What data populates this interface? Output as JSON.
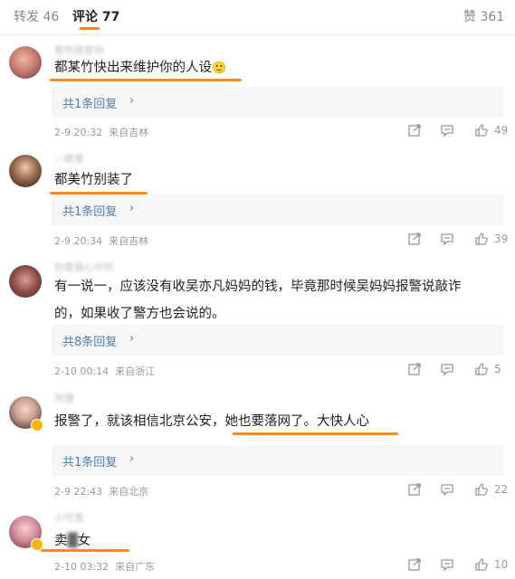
{
  "tabs": {
    "reposts": "转发 46",
    "comments": "评论 77",
    "likes": "赞 361"
  },
  "comments": [
    {
      "username": "爱的就是你",
      "text_line1": "都某竹快出来维护你的人设",
      "text_line2": "",
      "emoji": "🙂",
      "reply": "共1条回复",
      "date": "2-9 20:32",
      "source": "来自吉林",
      "likes": "49"
    },
    {
      "username": "一娘爱",
      "text_line1": "都美竹别装了",
      "text_line2": "",
      "reply": "共1条回复",
      "date": "2-9 20:34",
      "source": "来自吉林",
      "likes": "39"
    },
    {
      "username": "你是我心中的",
      "text_line1": "有一说一，应该没有收吴亦凡妈妈的钱，毕竟那时候吴妈妈报警说敲诈",
      "text_line2": "的，如果收了警方也会说的。",
      "reply": "共8条回复",
      "date": "2-10 00:14",
      "source": "来自浙江",
      "likes": "5"
    },
    {
      "username": "阿狸",
      "text_line1": "报警了，就该相信北京公安，她也要落网了。大快人心",
      "text_line2": "",
      "reply": "共1条回复",
      "date": "2-9 22:43",
      "source": "来自北京",
      "likes": "22"
    },
    {
      "username": "小可爱",
      "text_line1": "卖",
      "text_line2": "女",
      "reply": "",
      "date": "2-10 03:32",
      "source": "来自广东",
      "likes": "10"
    }
  ],
  "colors": {
    "accent": "#ff8200",
    "link": "#507daf",
    "highlight": "#ff8a1f"
  },
  "icons": [
    "share-icon",
    "comment-icon",
    "like-icon",
    "arrow-right-icon",
    "verified-badge-icon"
  ]
}
